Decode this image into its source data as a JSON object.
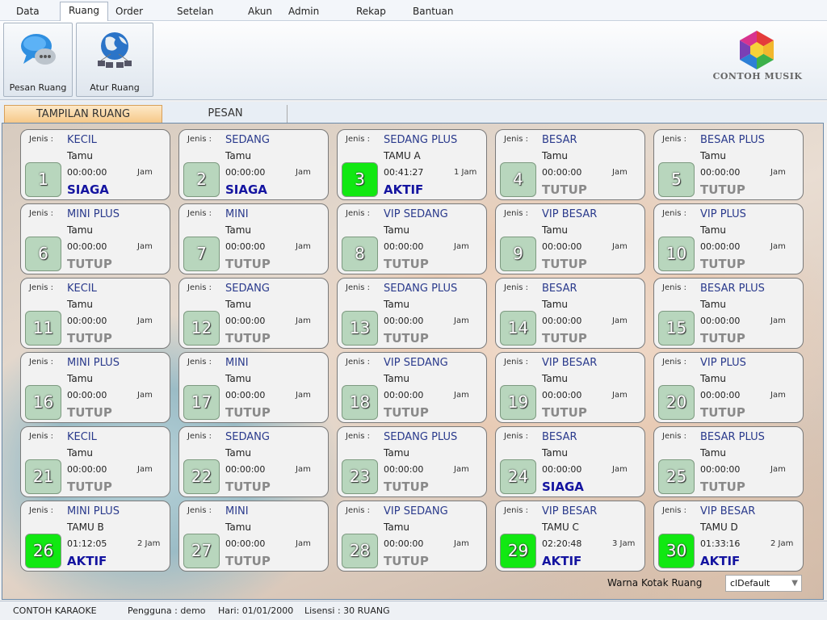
{
  "menu": [
    "Data",
    "Ruang",
    "Order",
    "Setelan",
    "Akun",
    "Admin",
    "Rekap",
    "Bantuan"
  ],
  "ribbon": {
    "chat_label": "Pesan Ruang",
    "manage_label": "Atur Ruang",
    "logo_text": "CONTOH MUSIK"
  },
  "tabs": {
    "display": "TAMPILAN RUANG",
    "chat": "PESAN"
  },
  "labels": {
    "rtype": "Jenis :",
    "jam": "Jam",
    "ganti_warna": "Warna Kotak Ruang"
  },
  "color_combo": {
    "value": "clDefault"
  },
  "status": {
    "app": "CONTOH KARAOKE",
    "user": "Pengguna : demo",
    "tanggal": "Hari: 01/01/2000",
    "reg": "Lisensi : 30 RUANG"
  },
  "rooms": [
    {
      "no": "1",
      "type": "KECIL",
      "name": "Tamu",
      "time": "00:00:00",
      "jam": "Jam",
      "status": "SIAGA"
    },
    {
      "no": "2",
      "type": "SEDANG",
      "name": "Tamu",
      "time": "00:00:00",
      "jam": "Jam",
      "status": "SIAGA"
    },
    {
      "no": "3",
      "type": "SEDANG PLUS",
      "name": "TAMU A",
      "time": "00:41:27",
      "jam": "1 Jam",
      "status": "AKTIF"
    },
    {
      "no": "4",
      "type": "BESAR",
      "name": "Tamu",
      "time": "00:00:00",
      "jam": "Jam",
      "status": "TUTUP"
    },
    {
      "no": "5",
      "type": "BESAR PLUS",
      "name": "Tamu",
      "time": "00:00:00",
      "jam": "Jam",
      "status": "TUTUP"
    },
    {
      "no": "6",
      "type": "MINI PLUS",
      "name": "Tamu",
      "time": "00:00:00",
      "jam": "Jam",
      "status": "TUTUP"
    },
    {
      "no": "7",
      "type": "MINI",
      "name": "Tamu",
      "time": "00:00:00",
      "jam": "Jam",
      "status": "TUTUP"
    },
    {
      "no": "8",
      "type": "VIP SEDANG",
      "name": "Tamu",
      "time": "00:00:00",
      "jam": "Jam",
      "status": "TUTUP"
    },
    {
      "no": "9",
      "type": "VIP BESAR",
      "name": "Tamu",
      "time": "00:00:00",
      "jam": "Jam",
      "status": "TUTUP"
    },
    {
      "no": "10",
      "type": "VIP PLUS",
      "name": "Tamu",
      "time": "00:00:00",
      "jam": "Jam",
      "status": "TUTUP"
    },
    {
      "no": "11",
      "type": "KECIL",
      "name": "Tamu",
      "time": "00:00:00",
      "jam": "Jam",
      "status": "TUTUP"
    },
    {
      "no": "12",
      "type": "SEDANG",
      "name": "Tamu",
      "time": "00:00:00",
      "jam": "Jam",
      "status": "TUTUP"
    },
    {
      "no": "13",
      "type": "SEDANG PLUS",
      "name": "Tamu",
      "time": "00:00:00",
      "jam": "Jam",
      "status": "TUTUP"
    },
    {
      "no": "14",
      "type": "BESAR",
      "name": "Tamu",
      "time": "00:00:00",
      "jam": "Jam",
      "status": "TUTUP"
    },
    {
      "no": "15",
      "type": "BESAR PLUS",
      "name": "Tamu",
      "time": "00:00:00",
      "jam": "Jam",
      "status": "TUTUP"
    },
    {
      "no": "16",
      "type": "MINI PLUS",
      "name": "Tamu",
      "time": "00:00:00",
      "jam": "Jam",
      "status": "TUTUP"
    },
    {
      "no": "17",
      "type": "MINI",
      "name": "Tamu",
      "time": "00:00:00",
      "jam": "Jam",
      "status": "TUTUP"
    },
    {
      "no": "18",
      "type": "VIP SEDANG",
      "name": "Tamu",
      "time": "00:00:00",
      "jam": "Jam",
      "status": "TUTUP"
    },
    {
      "no": "19",
      "type": "VIP BESAR",
      "name": "Tamu",
      "time": "00:00:00",
      "jam": "Jam",
      "status": "TUTUP"
    },
    {
      "no": "20",
      "type": "VIP PLUS",
      "name": "Tamu",
      "time": "00:00:00",
      "jam": "Jam",
      "status": "TUTUP"
    },
    {
      "no": "21",
      "type": "KECIL",
      "name": "Tamu",
      "time": "00:00:00",
      "jam": "Jam",
      "status": "TUTUP"
    },
    {
      "no": "22",
      "type": "SEDANG",
      "name": "Tamu",
      "time": "00:00:00",
      "jam": "Jam",
      "status": "TUTUP"
    },
    {
      "no": "23",
      "type": "SEDANG PLUS",
      "name": "Tamu",
      "time": "00:00:00",
      "jam": "Jam",
      "status": "TUTUP"
    },
    {
      "no": "24",
      "type": "BESAR",
      "name": "Tamu",
      "time": "00:00:00",
      "jam": "Jam",
      "status": "SIAGA"
    },
    {
      "no": "25",
      "type": "BESAR PLUS",
      "name": "Tamu",
      "time": "00:00:00",
      "jam": "Jam",
      "status": "TUTUP"
    },
    {
      "no": "26",
      "type": "MINI PLUS",
      "name": "TAMU B",
      "time": "01:12:05",
      "jam": "2 Jam",
      "status": "AKTIF"
    },
    {
      "no": "27",
      "type": "MINI",
      "name": "Tamu",
      "time": "00:00:00",
      "jam": "Jam",
      "status": "TUTUP"
    },
    {
      "no": "28",
      "type": "VIP SEDANG",
      "name": "Tamu",
      "time": "00:00:00",
      "jam": "Jam",
      "status": "TUTUP"
    },
    {
      "no": "29",
      "type": "VIP BESAR",
      "name": "TAMU C",
      "time": "02:20:48",
      "jam": "3 Jam",
      "status": "AKTIF"
    },
    {
      "no": "30",
      "type": "VIP BESAR",
      "name": "TAMU D",
      "time": "01:33:16",
      "jam": "2 Jam",
      "status": "AKTIF"
    }
  ],
  "colors": {
    "active_box": "#11e812",
    "idle_box": "#b8d6bd",
    "status_on": "#1414a0",
    "status_off": "#8a8a8a",
    "type_text": "#2a3a8c"
  }
}
